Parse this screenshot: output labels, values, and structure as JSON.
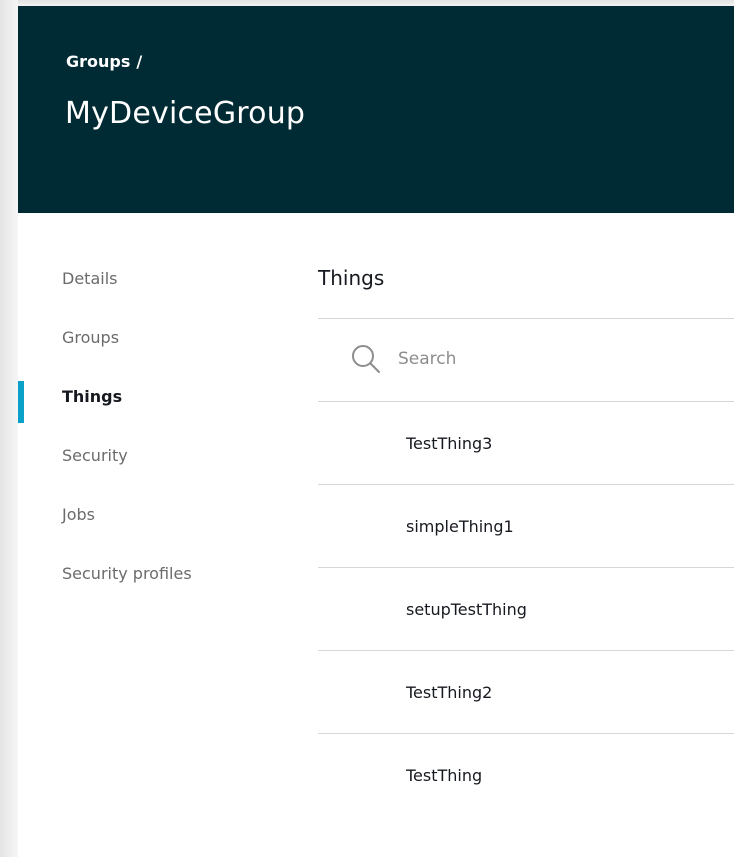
{
  "header": {
    "breadcrumb_link": "Groups",
    "breadcrumb_separator": "/",
    "title": "MyDeviceGroup",
    "background": "#012b34"
  },
  "sidebar": {
    "accent_color": "#0aa1c9",
    "items": [
      {
        "label": "Details",
        "active": false
      },
      {
        "label": "Groups",
        "active": false
      },
      {
        "label": "Things",
        "active": true
      },
      {
        "label": "Security",
        "active": false
      },
      {
        "label": "Jobs",
        "active": false
      },
      {
        "label": "Security profiles",
        "active": false
      }
    ]
  },
  "main": {
    "section_title": "Things",
    "search": {
      "placeholder": "Search",
      "value": "",
      "icon": "search-icon"
    },
    "things": [
      {
        "name": "TestThing3"
      },
      {
        "name": "simpleThing1"
      },
      {
        "name": "setupTestThing"
      },
      {
        "name": "TestThing2"
      },
      {
        "name": "TestThing"
      }
    ]
  }
}
